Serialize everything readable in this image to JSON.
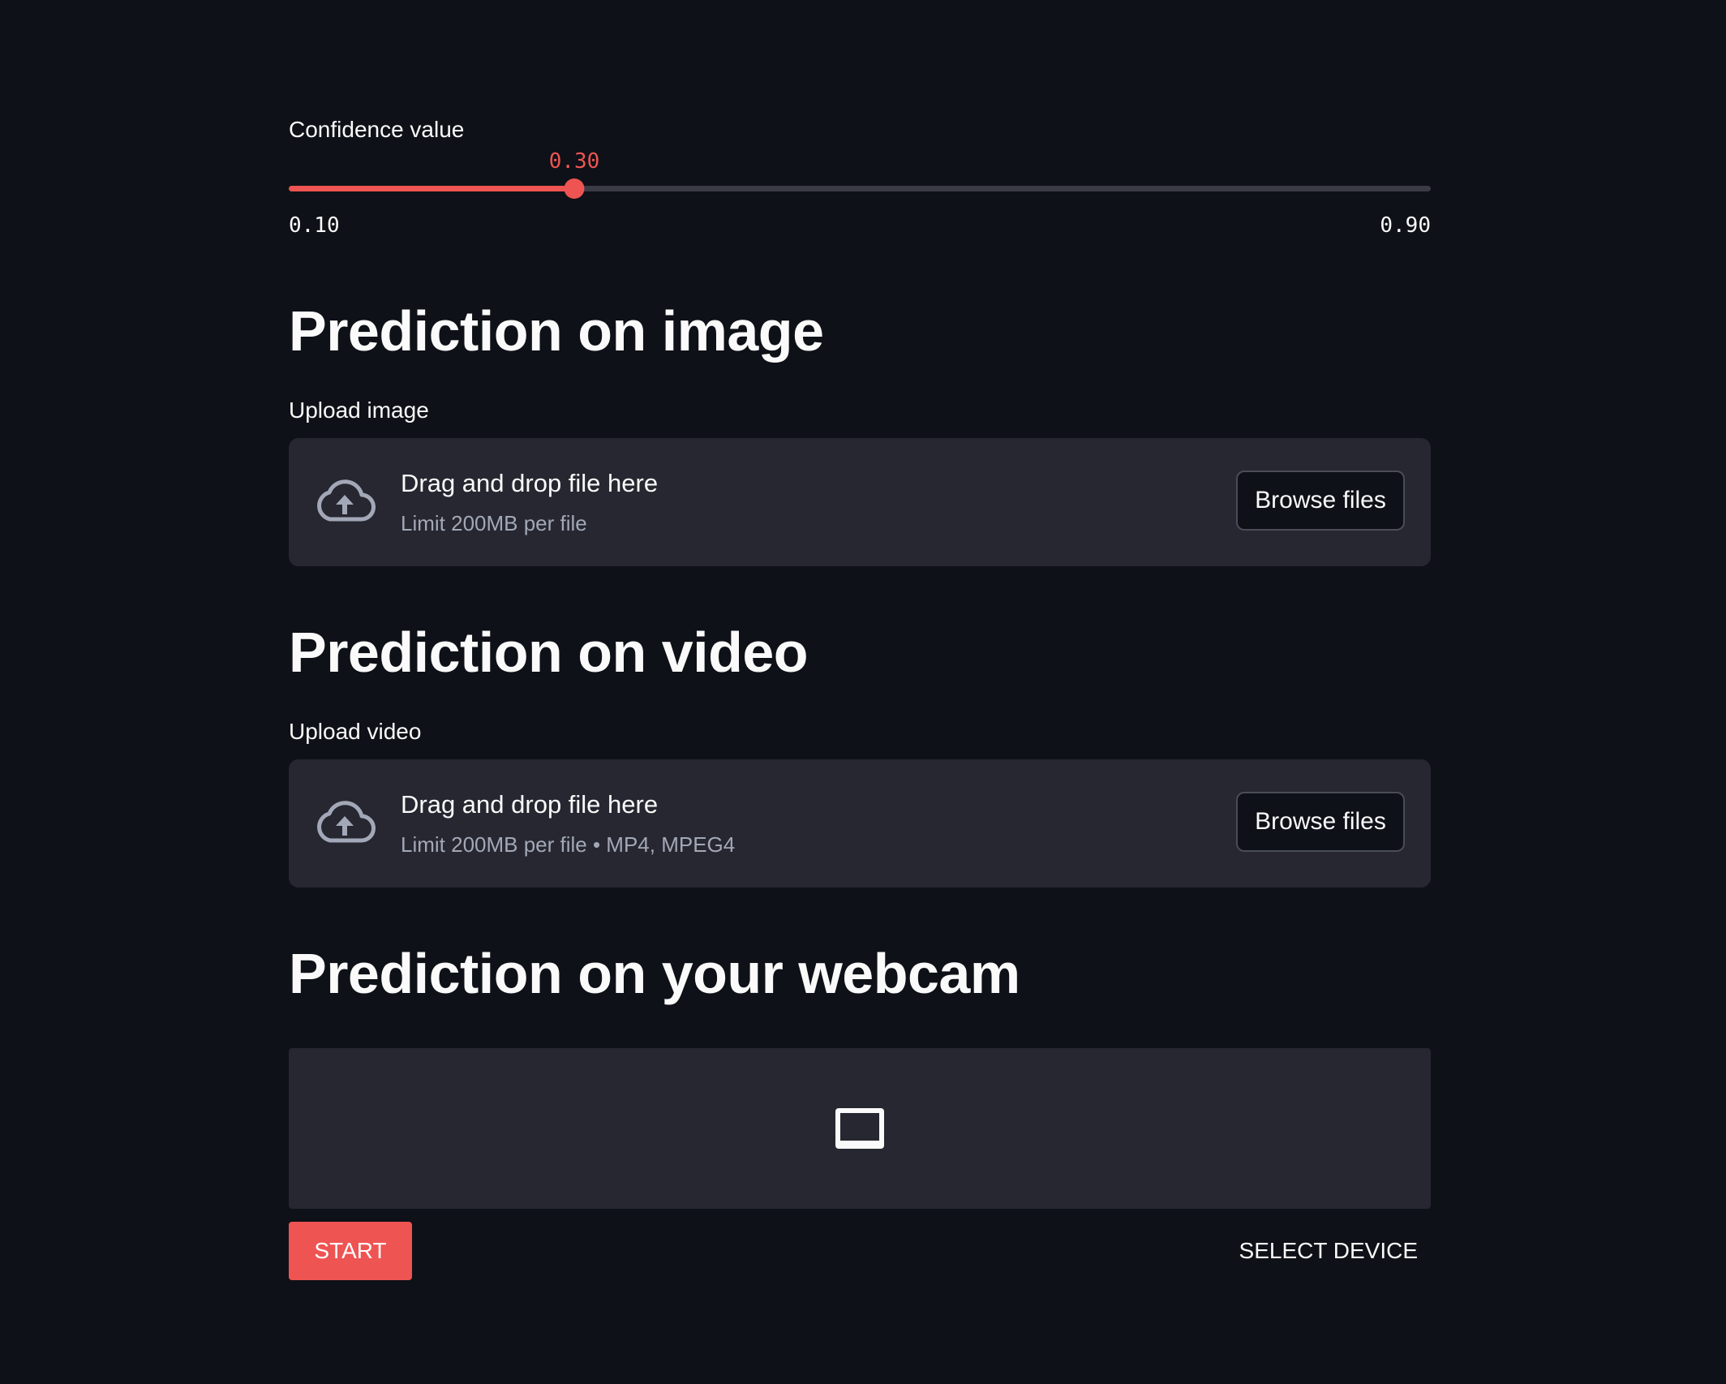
{
  "colors": {
    "background": "#0e1117",
    "accent": "#ee5452",
    "surface": "#262730"
  },
  "slider": {
    "label": "Confidence value",
    "value": "0.30",
    "min": "0.10",
    "max": "0.90",
    "value_num": 0.3,
    "min_num": 0.1,
    "max_num": 0.9
  },
  "image_section": {
    "title": "Prediction on image",
    "upload_label": "Upload image",
    "dropzone_title": "Drag and drop file here",
    "dropzone_limit": "Limit 200MB per file",
    "browse_label": "Browse files",
    "icon": "cloud-upload-icon"
  },
  "video_section": {
    "title": "Prediction on video",
    "upload_label": "Upload video",
    "dropzone_title": "Drag and drop file here",
    "dropzone_limit": "Limit 200MB per file • MP4, MPEG4",
    "browse_label": "Browse files",
    "icon": "cloud-upload-icon"
  },
  "webcam_section": {
    "title": "Prediction on your webcam",
    "icon": "video-frame-icon",
    "start_label": "START",
    "select_device_label": "SELECT DEVICE"
  }
}
